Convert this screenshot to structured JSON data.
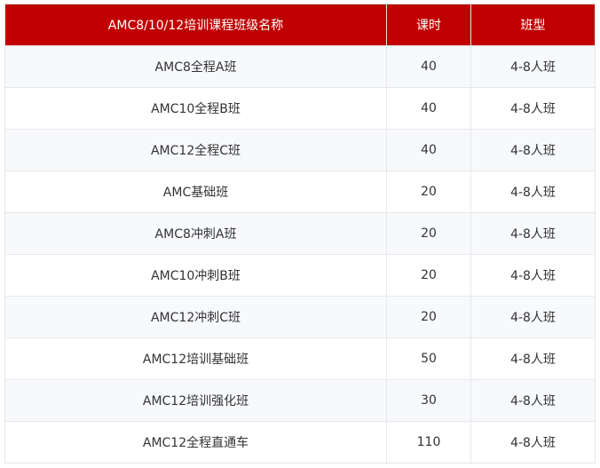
{
  "table": {
    "headers": [
      "AMC8/10/12培训课程班级名称",
      "课时",
      "班型"
    ],
    "rows": [
      [
        "AMC8全程A班",
        "40",
        "4-8人班"
      ],
      [
        "AMC10全程B班",
        "40",
        "4-8人班"
      ],
      [
        "AMC12全程C班",
        "40",
        "4-8人班"
      ],
      [
        "AMC基础班",
        "20",
        "4-8人班"
      ],
      [
        "AMC8冲刺A班",
        "20",
        "4-8人班"
      ],
      [
        "AMC10冲刺B班",
        "20",
        "4-8人班"
      ],
      [
        "AMC12冲刺C班",
        "20",
        "4-8人班"
      ],
      [
        "AMC12培训基础班",
        "50",
        "4-8人班"
      ],
      [
        "AMC12培训强化班",
        "30",
        "4-8人班"
      ],
      [
        "AMC12全程直通车",
        "110",
        "4-8人班"
      ]
    ]
  },
  "colors": {
    "header_bg": "#c00000",
    "header_text": "#ffffff",
    "row_alt_bg": "#f7f9fc",
    "cell_text": "#333333"
  }
}
